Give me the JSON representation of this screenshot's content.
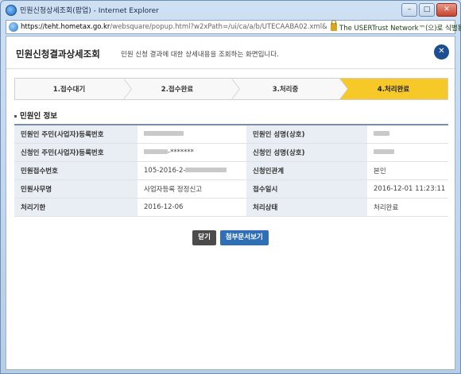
{
  "window": {
    "title": "민원신청상세조회(팝업) - Internet Explorer",
    "url_host": "https://teht.hometax.go.kr",
    "url_rest": "/websquare/popup.html?w2xPath=/ui/ca/a/b/UTECAABA02.xml&pop",
    "certificate": "The USERTrust Network™(으)로 식별됨",
    "min_label": "–",
    "max_label": "□",
    "close_label": "✕"
  },
  "header": {
    "title": "민원신청결과상세조회",
    "description": "민원 신청 결과에 대한 상세내용을 조회하는 화면입니다.",
    "close_label": "✕"
  },
  "steps": [
    {
      "label": "1.접수대기",
      "active": false
    },
    {
      "label": "2.접수완료",
      "active": false
    },
    {
      "label": "3.처리중",
      "active": false
    },
    {
      "label": "4.처리완료",
      "active": true
    }
  ],
  "section": {
    "title": "민원인 정보"
  },
  "info_rows": [
    {
      "l1": "민원인 주민(사업자)등록번호",
      "v1": "",
      "l2": "민원인 성명(상호)",
      "v2": ""
    },
    {
      "l1": "신청인 주민(사업자)등록번호",
      "v1": "-*******",
      "l2": "신청인 성명(상호)",
      "v2": ""
    },
    {
      "l1": "민원접수번호",
      "v1": "105-2016-2-",
      "l2": "신청인관계",
      "v2": "본인"
    },
    {
      "l1": "민원사무명",
      "v1": "사업자등록 정정신고",
      "l2": "접수일시",
      "v2": "2016-12-01 11:23:11"
    },
    {
      "l1": "처리기한",
      "v1": "2016-12-06",
      "l2": "처리상태",
      "v2": "처리완료"
    }
  ],
  "buttons": {
    "close": "닫기",
    "attachments": "첨부문서보기"
  },
  "colors": {
    "active_step": "#f7c928",
    "primary_button": "#2f6fb5",
    "close_circle": "#1d4f90"
  }
}
